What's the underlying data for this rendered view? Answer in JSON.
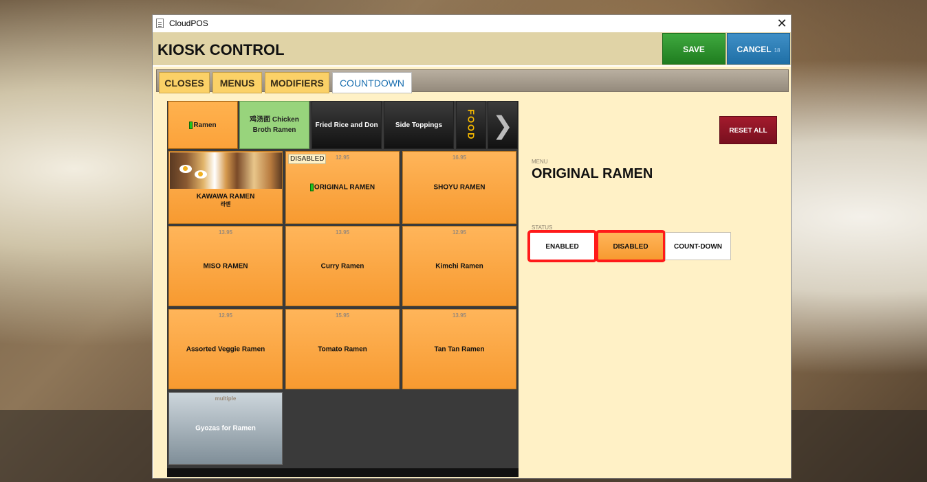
{
  "window": {
    "title": "CloudPOS",
    "close_glyph": "✕"
  },
  "header": {
    "title": "KIOSK CONTROL",
    "save_label": "SAVE",
    "cancel_label": "CANCEL",
    "cancel_count": "18"
  },
  "tabs": [
    {
      "label": "CLOSES",
      "active": false
    },
    {
      "label": "MENUS",
      "active": false
    },
    {
      "label": "MODIFIERS",
      "active": false
    },
    {
      "label": "COUNTDOWN",
      "active": true
    }
  ],
  "categories": [
    {
      "label": "Ramen",
      "style": "orange",
      "marked": true
    },
    {
      "label": "鸡汤面 Chicken Broth Ramen",
      "style": "green"
    },
    {
      "label": "Fried Rice and Don",
      "style": "dark"
    },
    {
      "label": "Side Toppings",
      "style": "dark"
    },
    {
      "label": "FOOD",
      "style": "food"
    },
    {
      "label": "❯",
      "style": "arrow"
    }
  ],
  "items": [
    {
      "name": "KAWAWA RAMEN",
      "sub": "라멘",
      "price": "",
      "has_image": true
    },
    {
      "name": "ORIGINAL RAMEN",
      "price": "12.95",
      "badge": "DISABLED",
      "marked": true
    },
    {
      "name": "SHOYU RAMEN",
      "price": "16.95"
    },
    {
      "name": "MISO RAMEN",
      "price": "13.95"
    },
    {
      "name": "Curry Ramen",
      "price": "13.95"
    },
    {
      "name": "Kimchi Ramen",
      "price": "12.95"
    },
    {
      "name": "Assorted Veggie Ramen",
      "price": "12.95"
    },
    {
      "name": "Tomato Ramen",
      "price": "15.95"
    },
    {
      "name": "Tan Tan Ramen",
      "price": "13.95"
    },
    {
      "name": "Gyozas for Ramen",
      "price": "multiple",
      "style": "gray"
    }
  ],
  "detail": {
    "reset_label": "RESET ALL",
    "menu_label": "MENU",
    "menu_value": "ORIGINAL RAMEN",
    "status_label": "STATUS",
    "status_options": [
      "ENABLED",
      "DISABLED",
      "COUNT-DOWN"
    ],
    "status_selected": "DISABLED"
  },
  "colors": {
    "save": "#2a8f2a",
    "cancel": "#2a7fb6",
    "reset": "#8c1525",
    "item_orange": "#fba23a",
    "active_tab_text": "#1a6fb0",
    "selection_ring": "#ff1a1a"
  }
}
